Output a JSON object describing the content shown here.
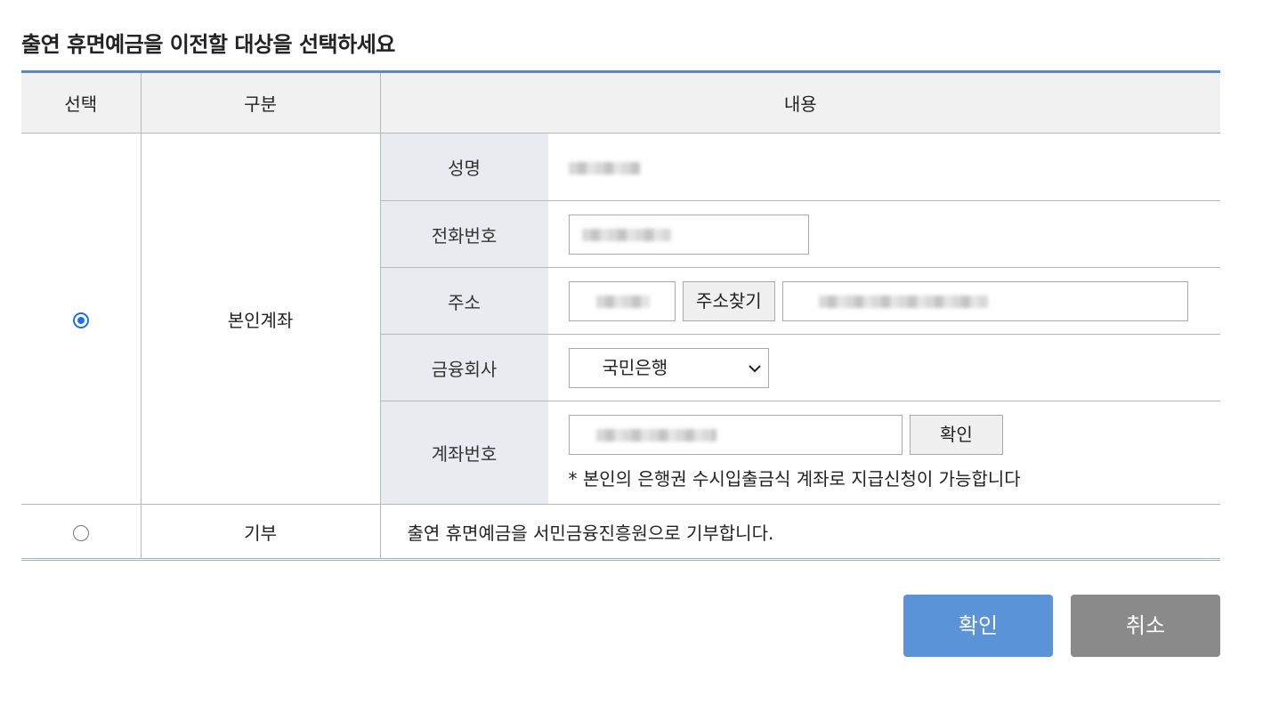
{
  "title": "출연 휴면예금을 이전할 대상을 선택하세요",
  "table": {
    "headers": {
      "select": "선택",
      "category": "구분",
      "content": "내용"
    },
    "own_account": {
      "selected": true,
      "category": "본인계좌",
      "fields": {
        "name_label": "성명",
        "phone_label": "전화번호",
        "address_label": "주소",
        "address_search_button": "주소찾기",
        "bank_label": "금융회사",
        "bank_selected": "국민은행",
        "account_label": "계좌번호",
        "account_verify_button": "확인",
        "account_note": "* 본인의 은행권 수시입출금식 계좌로 지급신청이 가능합니다"
      }
    },
    "donation": {
      "selected": false,
      "category": "기부",
      "description": "출연 휴면예금을 서민금융진흥원으로 기부합니다."
    }
  },
  "buttons": {
    "confirm": "확인",
    "cancel": "취소"
  },
  "colors": {
    "accent": "#5b93d9",
    "table_top_border": "#5b87c9",
    "cancel": "#8a8a8a",
    "radio_selected": "#1a73e8"
  },
  "icons": {
    "bank_dropdown": "chevron-down-icon"
  }
}
